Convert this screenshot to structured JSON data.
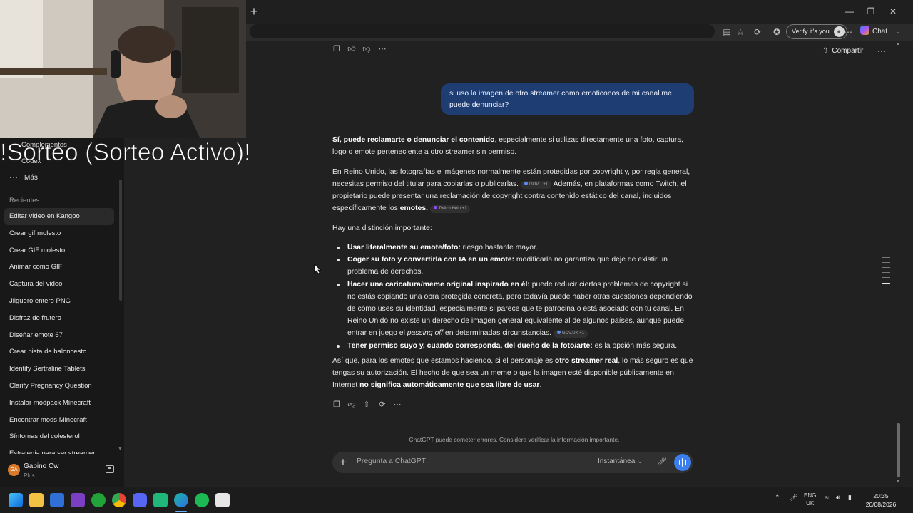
{
  "browser": {
    "verify_label": "Verify it's you",
    "chat_label": "Chat"
  },
  "overlay": {
    "text": "!Sorteo (Sorteo Activo)!"
  },
  "sidebar_behind": {
    "item1": "Complementos",
    "item2": "Codex"
  },
  "sidebar": {
    "more_label": "Más",
    "recents_heading": "Recientes",
    "items": [
      {
        "label": "Editar video en Kangoo"
      },
      {
        "label": "Crear gif molesto"
      },
      {
        "label": "Crear GIF molesto"
      },
      {
        "label": "Animar como GIF"
      },
      {
        "label": "Captura del video"
      },
      {
        "label": "Jilguero entero PNG"
      },
      {
        "label": "Disfraz de frutero"
      },
      {
        "label": "Diseñar emote 67"
      },
      {
        "label": "Crear pista de baloncesto"
      },
      {
        "label": "Identify Sertraline Tablets"
      },
      {
        "label": "Clarify Pregnancy Question"
      },
      {
        "label": "Instalar modpack Minecraft"
      },
      {
        "label": "Encontrar mods Minecraft"
      },
      {
        "label": "Síntomas del colesterol"
      },
      {
        "label": "Estrategia para ser streamer"
      }
    ],
    "user": {
      "initials": "GA",
      "name": "Gabino Cw",
      "plan": "Plus"
    }
  },
  "header": {
    "share_label": "Compartir"
  },
  "conversation": {
    "user_message": "si uso la imagen de otro streamer como emoticonos de mi canal me puede denunciar?",
    "p1_bold": "Sí, puede reclamarte o denunciar el contenido",
    "p1_rest": ", especialmente si utilizas directamente una foto, captura, logo o emote perteneciente a otro streamer sin permiso.",
    "p2_a": "En Reino Unido, las fotografías e imágenes normalmente están protegidas por copyright y, por regla general, necesitas permiso del titular para copiarlas o publicarlas.",
    "chip1": "GOV... +1",
    "p2_b": " Además, en plataformas como Twitch, el propietario puede presentar una reclamación de copyright contra contenido estático del canal, incluidos específicamente los ",
    "p2_bold": "emotes.",
    "chip2": "Twitch Help +1",
    "p3": "Hay una distinción importante:",
    "b1_bold": "Usar literalmente su emote/foto:",
    "b1_rest": " riesgo bastante mayor.",
    "b2_bold": "Coger su foto y convertirla con IA en un emote:",
    "b2_rest": " modificarla no garantiza que deje de existir un problema de derechos.",
    "b3_bold": "Hacer una caricatura/meme original inspirado en él:",
    "b3_rest": " puede reducir ciertos problemas de copyright si no estás copiando una obra protegida concreta, pero todavía puede haber otras cuestiones dependiendo de cómo uses su identidad, especialmente si parece que te patrocina o está asociado con tu canal. En Reino Unido no existe un derecho de imagen general equivalente al de algunos países, aunque puede entrar en juego el ",
    "b3_italic": "passing off",
    "b3_end": " en determinadas circunstancias.",
    "chip3": "GOV.UK +1",
    "b4_bold": "Tener permiso suyo y, cuando corresponda, del dueño de la foto/arte:",
    "b4_rest": " es la opción más segura.",
    "p4_a": "Así que, para los emotes que estamos haciendo, si el personaje es ",
    "p4_bold1": "otro streamer real",
    "p4_b": ", lo más seguro es que tengas su autorización. El hecho de que sea un meme o que la imagen esté disponible públicamente en Internet ",
    "p4_bold2": "no significa automáticamente que sea libre de usar",
    "p4_end": "."
  },
  "footer": {
    "disclaimer": "ChatGPT puede cometer errores. Considera verificar la información importante."
  },
  "composer": {
    "placeholder": "Pregunta a ChatGPT",
    "model": "Instantánea"
  },
  "taskbar": {
    "lang": "ENG",
    "region": "UK",
    "time": "20:35",
    "date": "20/08/2026"
  },
  "colors": {
    "accent": "#3b7ef0",
    "user_bubble": "#1e3d72",
    "background": "#212121",
    "sidebar": "#181818"
  }
}
